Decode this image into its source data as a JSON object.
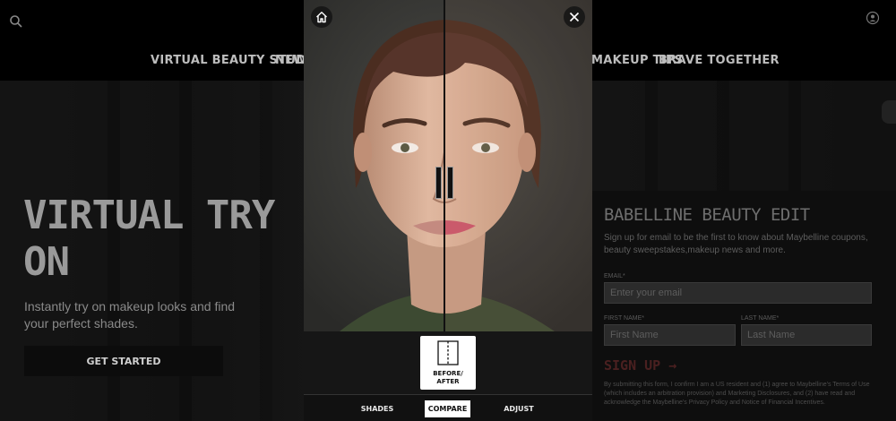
{
  "site": {
    "nav": [
      "VIRTUAL BEAUTY STUDIO",
      "NEW",
      "MAKEUP TIPS",
      "BRAVE TOGETHER"
    ],
    "hero": {
      "title": "VIRTUAL TRY ON",
      "subtitle": "Instantly try on makeup looks and find your perfect shades.",
      "cta": "GET STARTED"
    },
    "newsletter": {
      "title": "BABELLINE BEAUTY EDIT",
      "description": "Sign up for email to be the first to know about Maybelline coupons, beauty sweepstakes,makeup news and more.",
      "email_label": "EMAIL*",
      "email_placeholder": "Enter your email",
      "first_label": "FIRST NAME*",
      "first_placeholder": "First Name",
      "last_label": "LAST NAME*",
      "last_placeholder": "Last Name",
      "signup": "SIGN UP →",
      "legal": "By submitting this form, I confirm I am a US resident and (1) agree to Maybelline's Terms of Use (which includes an arbitration provision) and Marketing Disclosures, and (2) have read and acknowledge the Maybelline's Privacy Policy and Notice of Financial Incentives."
    }
  },
  "modal": {
    "compare_tool": {
      "label_line1": "BEFORE/",
      "label_line2": "AFTER"
    },
    "tabs": [
      {
        "label": "SHADES",
        "active": false
      },
      {
        "label": "COMPARE",
        "active": true
      },
      {
        "label": "ADJUST",
        "active": false
      }
    ],
    "icons": {
      "home": "home-icon",
      "close": "close-icon",
      "compare": "split-compare-icon",
      "handle": "drag-handle-icon"
    }
  },
  "colors": {
    "overlay_dim": "#000000",
    "modal_bg": "#111111",
    "active_tab": "#ffffff",
    "lip_after": "#c8566a"
  }
}
